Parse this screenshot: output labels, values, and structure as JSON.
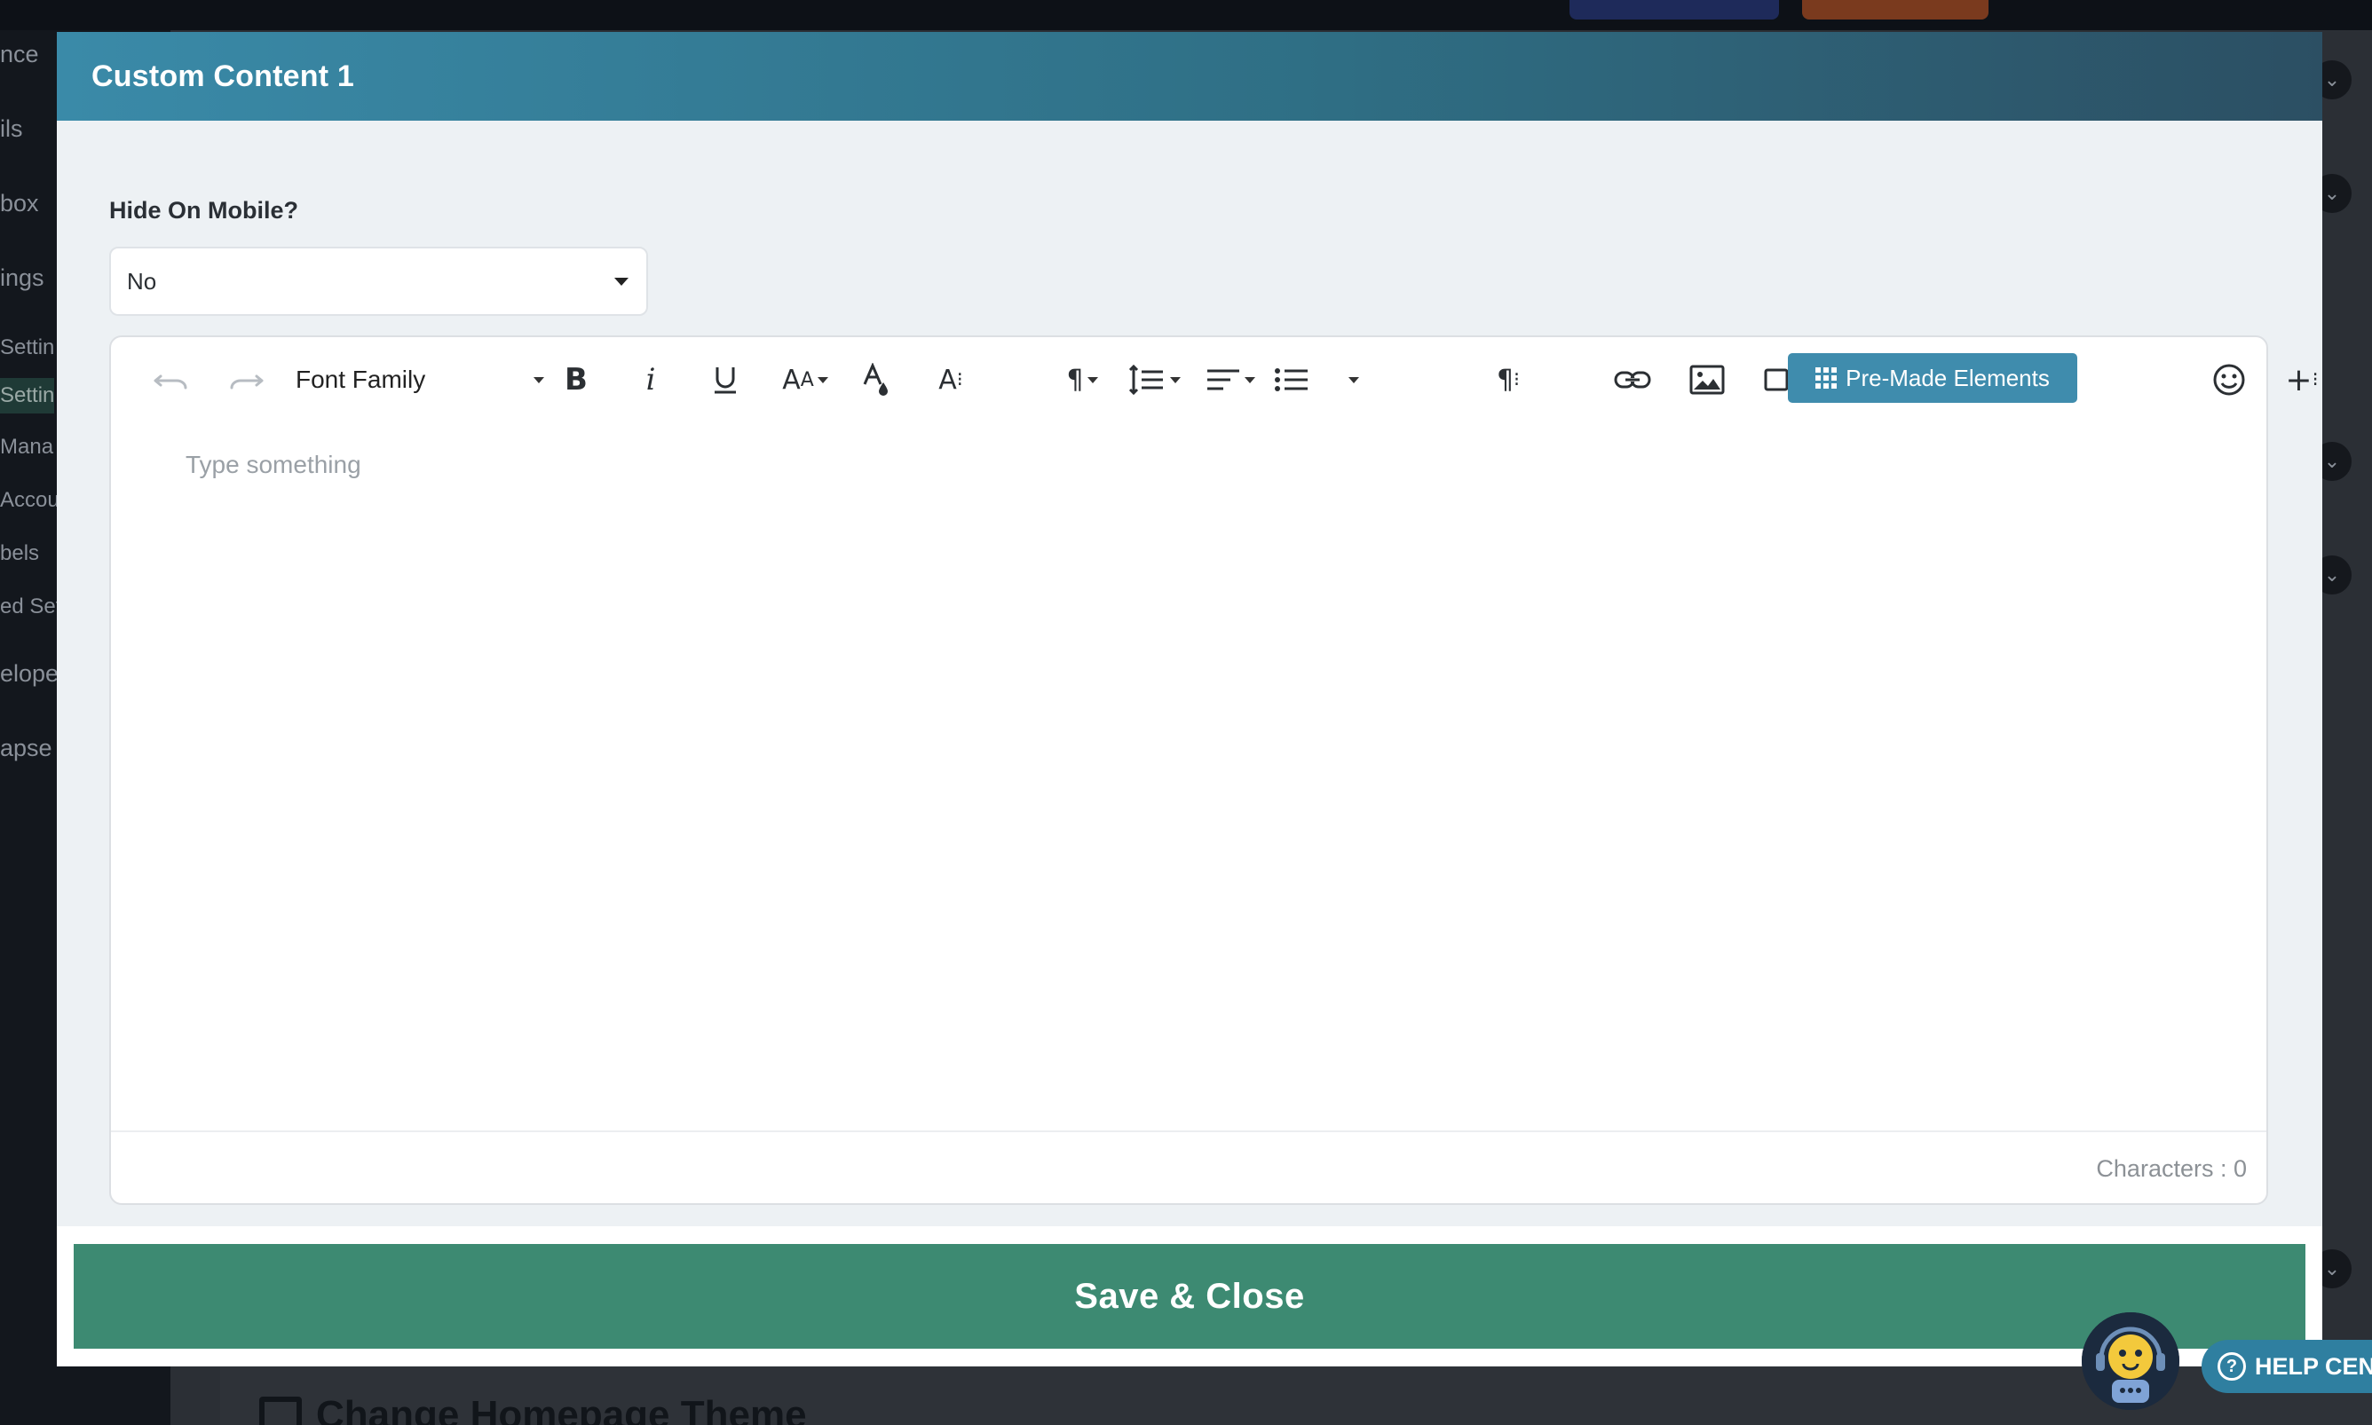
{
  "background": {
    "sidebar_items": [
      "nce",
      "ils",
      "box",
      "ings",
      "Settin",
      "Settin",
      "Mana",
      "Accou",
      "bels",
      "ed Set",
      "elope",
      "apse"
    ],
    "homepage_theme_title": "Change Homepage Theme"
  },
  "modal": {
    "title": "Custom Content 1",
    "hide_on_mobile": {
      "label": "Hide On Mobile?",
      "value": "No"
    },
    "editor": {
      "toolbar": {
        "undo_icon": "undo-icon",
        "redo_icon": "redo-icon",
        "font_family_label": "Font Family",
        "premade_label": "Pre-Made Elements"
      },
      "placeholder": "Type something",
      "char_count": "Characters : 0"
    },
    "save_label": "Save & Close"
  },
  "help_center": {
    "label": "HELP CEN"
  },
  "colors": {
    "header_start": "#3a8aa8",
    "header_end": "#2c4f63",
    "save_button": "#3d8a72",
    "premade_button": "#3f8cad",
    "help_button": "#2f7fa0"
  }
}
